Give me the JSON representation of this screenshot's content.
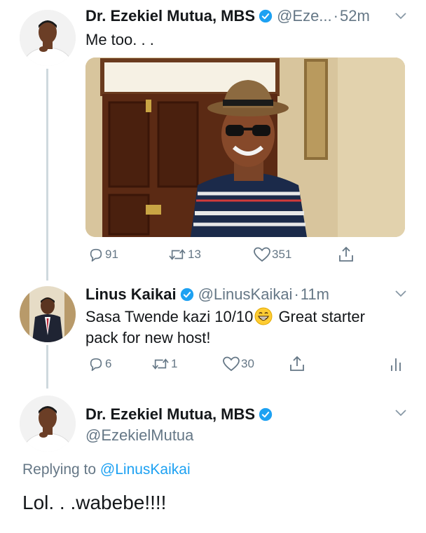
{
  "tweet1": {
    "author_name": "Dr. Ezekiel Mutua, MBS",
    "handle": "@Eze...",
    "separator": "·",
    "time": "52m",
    "text": "Me too. . .",
    "actions": {
      "replies": "91",
      "retweets": "13",
      "likes": "351"
    }
  },
  "tweet2": {
    "author_name": "Linus Kaikai",
    "handle": "@LinusKaikai",
    "separator": "·",
    "time": "11m",
    "text_before_emoji": "Sasa Twende kazi 10/10",
    "text_after_emoji": " Great starter",
    "text_line2": "pack for new host!",
    "actions": {
      "replies": "6",
      "retweets": "1",
      "likes": "30"
    }
  },
  "tweet3": {
    "author_name": "Dr. Ezekiel Mutua, MBS",
    "handle": "@EzekielMutua",
    "replying_prefix": "Replying to ",
    "replying_mention": "@LinusKaikai",
    "text": "Lol. . .wabebe!!!!"
  },
  "colors": {
    "verified": "#1da1f2",
    "muted": "#657786",
    "link": "#1da1f2",
    "thread_line": "#cfd9de"
  },
  "icons": [
    "reply-icon",
    "retweet-icon",
    "like-icon",
    "share-icon",
    "analytics-icon",
    "verified-badge-icon",
    "caret-down-icon",
    "grinning-emoji-icon"
  ]
}
